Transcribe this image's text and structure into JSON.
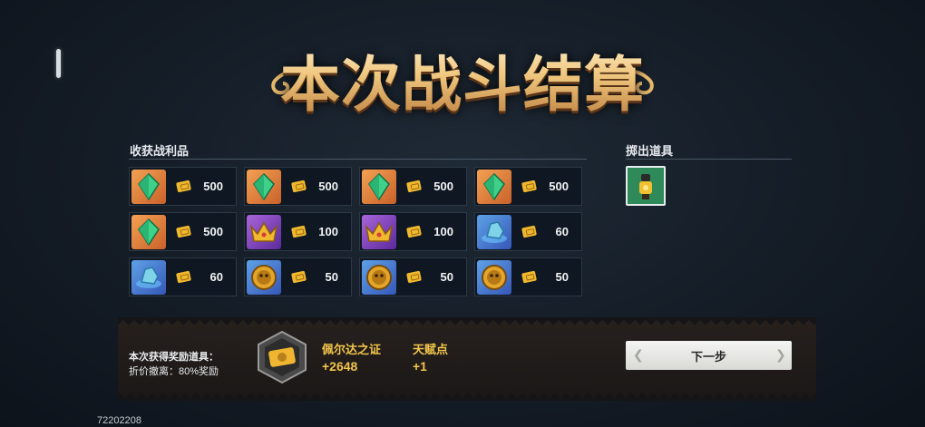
{
  "title": "本次战斗结算",
  "loot_section": {
    "label": "收获战利品"
  },
  "eject_section": {
    "label": "掷出道具",
    "item_icon": "lantern-figure-icon"
  },
  "loot": [
    {
      "icon": "green-crystal-icon",
      "bg": "orange",
      "amount": "500"
    },
    {
      "icon": "green-crystal-icon",
      "bg": "orange",
      "amount": "500"
    },
    {
      "icon": "green-crystal-icon",
      "bg": "orange",
      "amount": "500"
    },
    {
      "icon": "green-crystal-icon",
      "bg": "orange",
      "amount": "500"
    },
    {
      "icon": "green-crystal-icon",
      "bg": "orange",
      "amount": "500"
    },
    {
      "icon": "gold-crown-icon",
      "bg": "purple",
      "amount": "100"
    },
    {
      "icon": "gold-crown-icon",
      "bg": "purple",
      "amount": "100"
    },
    {
      "icon": "blue-ore-icon",
      "bg": "blue",
      "amount": "60"
    },
    {
      "icon": "blue-ore-icon",
      "bg": "blue",
      "amount": "60"
    },
    {
      "icon": "gold-coin-icon",
      "bg": "blue",
      "amount": "50"
    },
    {
      "icon": "gold-coin-icon",
      "bg": "blue",
      "amount": "50"
    },
    {
      "icon": "gold-coin-icon",
      "bg": "blue",
      "amount": "50"
    }
  ],
  "reward": {
    "heading": "本次获得奖励道具：",
    "discount": "折价撤离：80%奖励",
    "badge_icon": "gold-ticket-badge-icon",
    "items": [
      {
        "name": "佩尔达之证",
        "value": "+2648"
      },
      {
        "name": "天赋点",
        "value": "+1"
      }
    ]
  },
  "next_button": {
    "label": "下一步"
  },
  "build_id": "72202208",
  "colors": {
    "title_gold": "#f0c77e",
    "reward_gold": "#f2c54b",
    "panel": "#0f1822"
  }
}
